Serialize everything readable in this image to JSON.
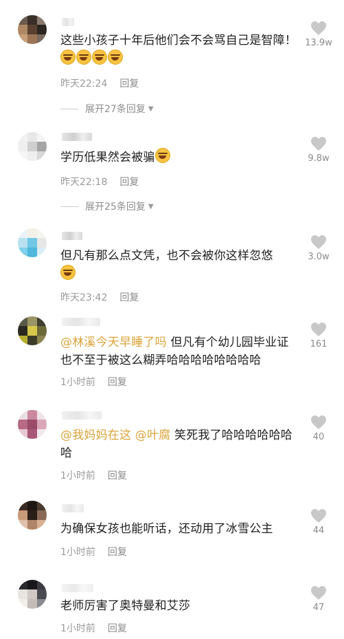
{
  "comments": [
    {
      "text_before": "这些小孩子十年后他们会不会骂自己是智障！",
      "emoji_count": 4,
      "time": "昨天22:24",
      "reply": "回复",
      "likes": "13.9w",
      "expand": "展开27条回复"
    },
    {
      "text_before": "学历低果然会被骗",
      "emoji_count": 1,
      "time": "昨天22:18",
      "reply": "回复",
      "likes": "9.8w",
      "expand": "展开25条回复"
    },
    {
      "text_before": "但凡有那么点文凭，也不会被你这样忽悠",
      "emoji_count": 1,
      "time": "昨天23:42",
      "reply": "回复",
      "likes": "3.0w"
    },
    {
      "mention": "@林溪今天早睡了吗",
      "text_after": " 但凡有个幼儿园毕业证也不至于被这么糊弄哈哈哈哈哈哈哈哈",
      "time": "1小时前",
      "reply": "回复",
      "likes": "161"
    },
    {
      "mention": "@我妈妈在这 @叶腐",
      "text_after": " 笑死我了哈哈哈哈哈哈哈",
      "time": "1小时前",
      "reply": "回复",
      "likes": "40"
    },
    {
      "text_before": "为确保女孩也能听话，还动用了冰雪公主",
      "time": "1小时前",
      "reply": "回复",
      "likes": "44"
    },
    {
      "text_before": "老师厉害了奥特曼和艾莎",
      "time": "1小时前",
      "reply": "回复",
      "likes": "47"
    }
  ],
  "icons": {
    "like": "heart-icon",
    "expand": "triangle-down-icon"
  },
  "colors": {
    "mention": "#d9a43a",
    "meta": "#9a9a9a",
    "heart": "#c8c8c8"
  }
}
